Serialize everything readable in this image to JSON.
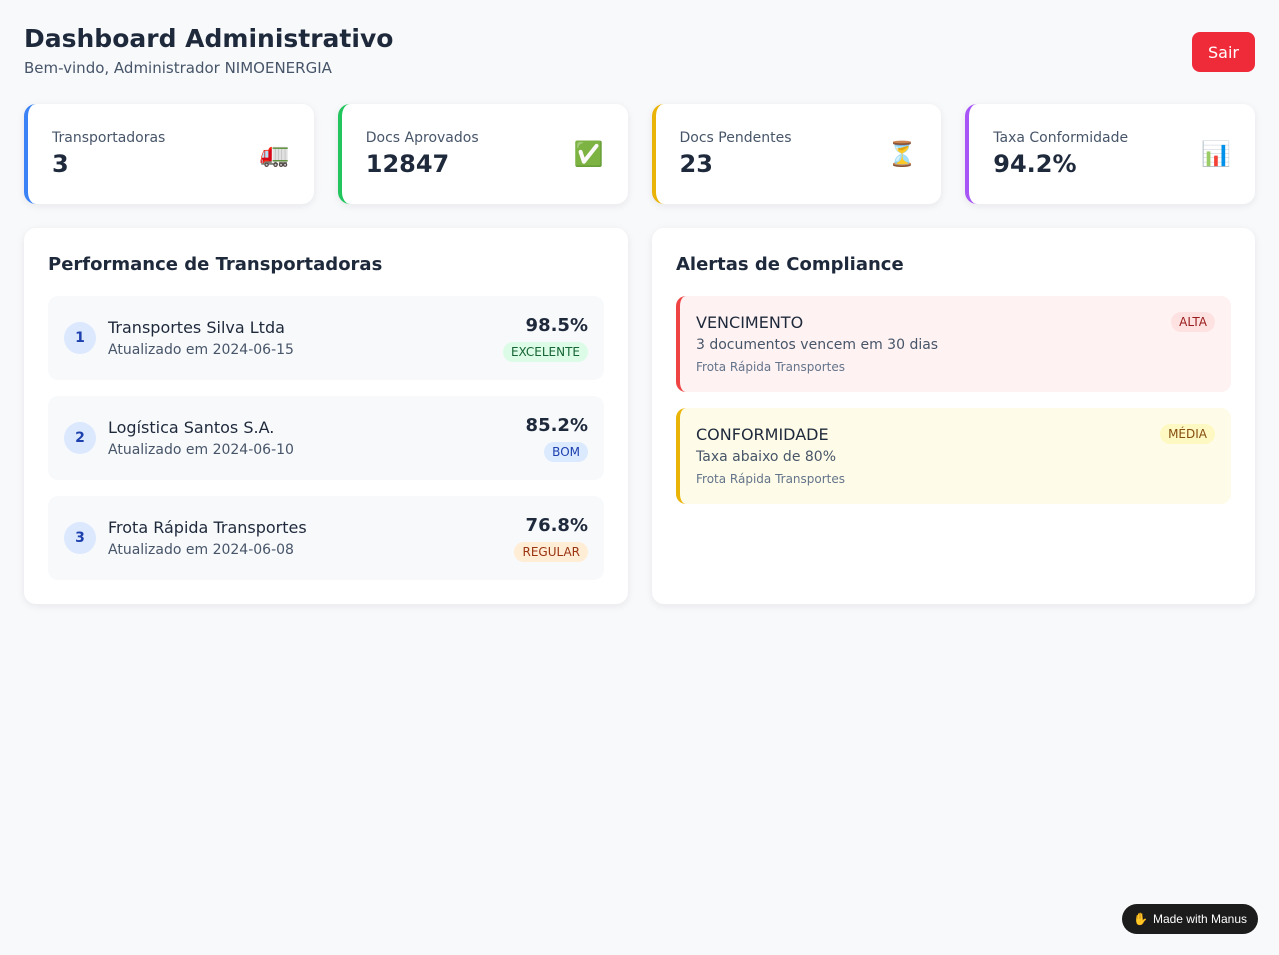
{
  "header": {
    "title": "Dashboard Administrativo",
    "subtitle": "Bem-vindo, Administrador NIMOENERGIA",
    "logout_label": "Sair"
  },
  "stats": [
    {
      "label": "Transportadoras",
      "value": "3",
      "icon": "🚛",
      "icon_name": "truck-icon",
      "accent": "#3b82f6"
    },
    {
      "label": "Docs Aprovados",
      "value": "12847",
      "icon": "✅",
      "icon_name": "check-icon",
      "accent": "#22c55e"
    },
    {
      "label": "Docs Pendentes",
      "value": "23",
      "icon": "⏳",
      "icon_name": "hourglass-icon",
      "accent": "#eab308"
    },
    {
      "label": "Taxa Conformidade",
      "value": "94.2%",
      "icon": "📊",
      "icon_name": "bar-chart-icon",
      "accent": "#a855f7"
    }
  ],
  "performance": {
    "title": "Performance de Transportadoras",
    "items": [
      {
        "rank": "1",
        "name": "Transportes Silva Ltda",
        "updated": "Atualizado em 2024-06-15",
        "score": "98.5%",
        "status": "EXCELENTE",
        "badge_bg": "#dcfce7",
        "badge_color": "#166534"
      },
      {
        "rank": "2",
        "name": "Logística Santos S.A.",
        "updated": "Atualizado em 2024-06-10",
        "score": "85.2%",
        "status": "BOM",
        "badge_bg": "#dbeafe",
        "badge_color": "#1e40af"
      },
      {
        "rank": "3",
        "name": "Frota Rápida Transportes",
        "updated": "Atualizado em 2024-06-08",
        "score": "76.8%",
        "status": "REGULAR",
        "badge_bg": "#ffedd5",
        "badge_color": "#9a3412"
      }
    ]
  },
  "alerts": {
    "title": "Alertas de Compliance",
    "items": [
      {
        "type": "VENCIMENTO",
        "message": "3 documentos vencem em 30 dias",
        "company": "Frota Rápida Transportes",
        "priority": "ALTA",
        "bg": "#fef2f2",
        "border": "#ef4444",
        "badge_bg": "#fee2e2",
        "badge_color": "#991b1b"
      },
      {
        "type": "CONFORMIDADE",
        "message": "Taxa abaixo de 80%",
        "company": "Frota Rápida Transportes",
        "priority": "MÉDIA",
        "bg": "#fefce8",
        "border": "#eab308",
        "badge_bg": "#fef9c3",
        "badge_color": "#854d0e"
      }
    ]
  },
  "footer": {
    "manus_label": "Made with Manus"
  }
}
